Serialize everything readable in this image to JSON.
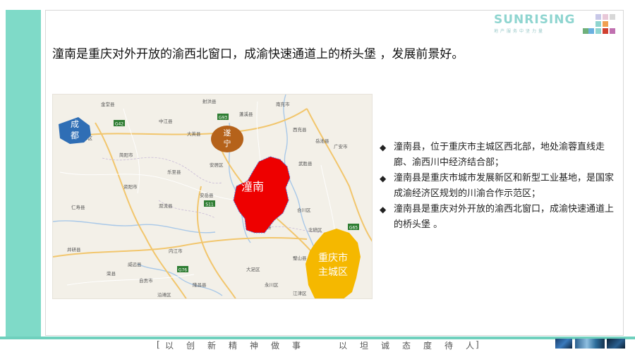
{
  "brand": {
    "name": "SUNRISING",
    "tagline": "地产服务中坚力量"
  },
  "logo_colors": [
    "#c8c8e8",
    "#e8c8d8",
    "#d8d8d8",
    "#8fd5d0",
    "#f0a050",
    "#6ab0e0",
    "#8fd5d0",
    "#d04030",
    "#c070b0",
    "#6fb07a"
  ],
  "headline": "潼南是重庆对外开放的渝西北窗口，成渝快速通道上的桥头堡 ，发展前景好。",
  "map": {
    "highlight_labels": {
      "chengdu_1": "成",
      "chengdu_2": "都",
      "suining_1": "遂",
      "suining_2": "宁",
      "tongnan": "潼南",
      "chongqing_1": "重庆市",
      "chongqing_2": "主城区"
    },
    "highlight_colors": {
      "chengdu": "#2f6eb5",
      "suining": "#b5621a",
      "tongnan": "#ee0000",
      "chongqing": "#f5b800"
    },
    "place_labels": {
      "jintang": "金堂县",
      "shehong": "射洪县",
      "nanchong": "南充市",
      "pengxi": "蓬溪县",
      "xichong": "西充县",
      "dayi": "大英县",
      "yuelai": "岳池县",
      "guangan": "广安市",
      "wusheng": "武胜县",
      "jianyang": "简阳市",
      "lezhi": "乐至县",
      "anju": "安居区",
      "ziyang": "资阳市",
      "anyue": "安岳县",
      "hechuan": "合川区",
      "tongliang": "铜梁县",
      "beibei": "北碚区",
      "renshou": "仁寿县",
      "weiyuan": "威远县",
      "neijiang": "内江市",
      "qianwei": "井研县",
      "dazu": "大足区",
      "bishan": "璧山县",
      "yongchuan": "永川区",
      "rongchang": "荣县",
      "zigong": "自贡市",
      "longchang": "隆昌县",
      "jiangjin": "江津区",
      "yanjiang": "沿滩区",
      "longquan": "龙泉驿区",
      "zhongjiang": "中江县",
      "shuangliu": "双流县",
      "qiongzhong": "中江县",
      "suining_city": "遂宁市",
      "lizhi": "渝北区"
    },
    "road_shields": {
      "g42": "G42",
      "g93": "G93",
      "g76": "G76",
      "s11": "S11",
      "g65": "G65"
    }
  },
  "bullets": [
    "潼南县，位于重庆市主城区西北部，地处渝蓉直线走廊、渝西川中经济结合部；",
    "潼南县是重庆市城市发展新区和新型工业基地，是国家成渝经济区规划的川渝合作示范区；",
    "潼南县是重庆对外开放的渝西北窗口，成渝快速通道上的桥头堡 。"
  ],
  "bullet_icon": "◆",
  "slogan": {
    "open": "[",
    "left": [
      "以",
      "创",
      "新",
      "精",
      "神",
      "做",
      "事"
    ],
    "right": [
      "以",
      "坦",
      "诚",
      "态",
      "度",
      "待",
      "人"
    ],
    "close": "]"
  },
  "footer_photos": [
    "city-photo-icon",
    "skyline-photo-icon",
    "night-photo-icon"
  ]
}
